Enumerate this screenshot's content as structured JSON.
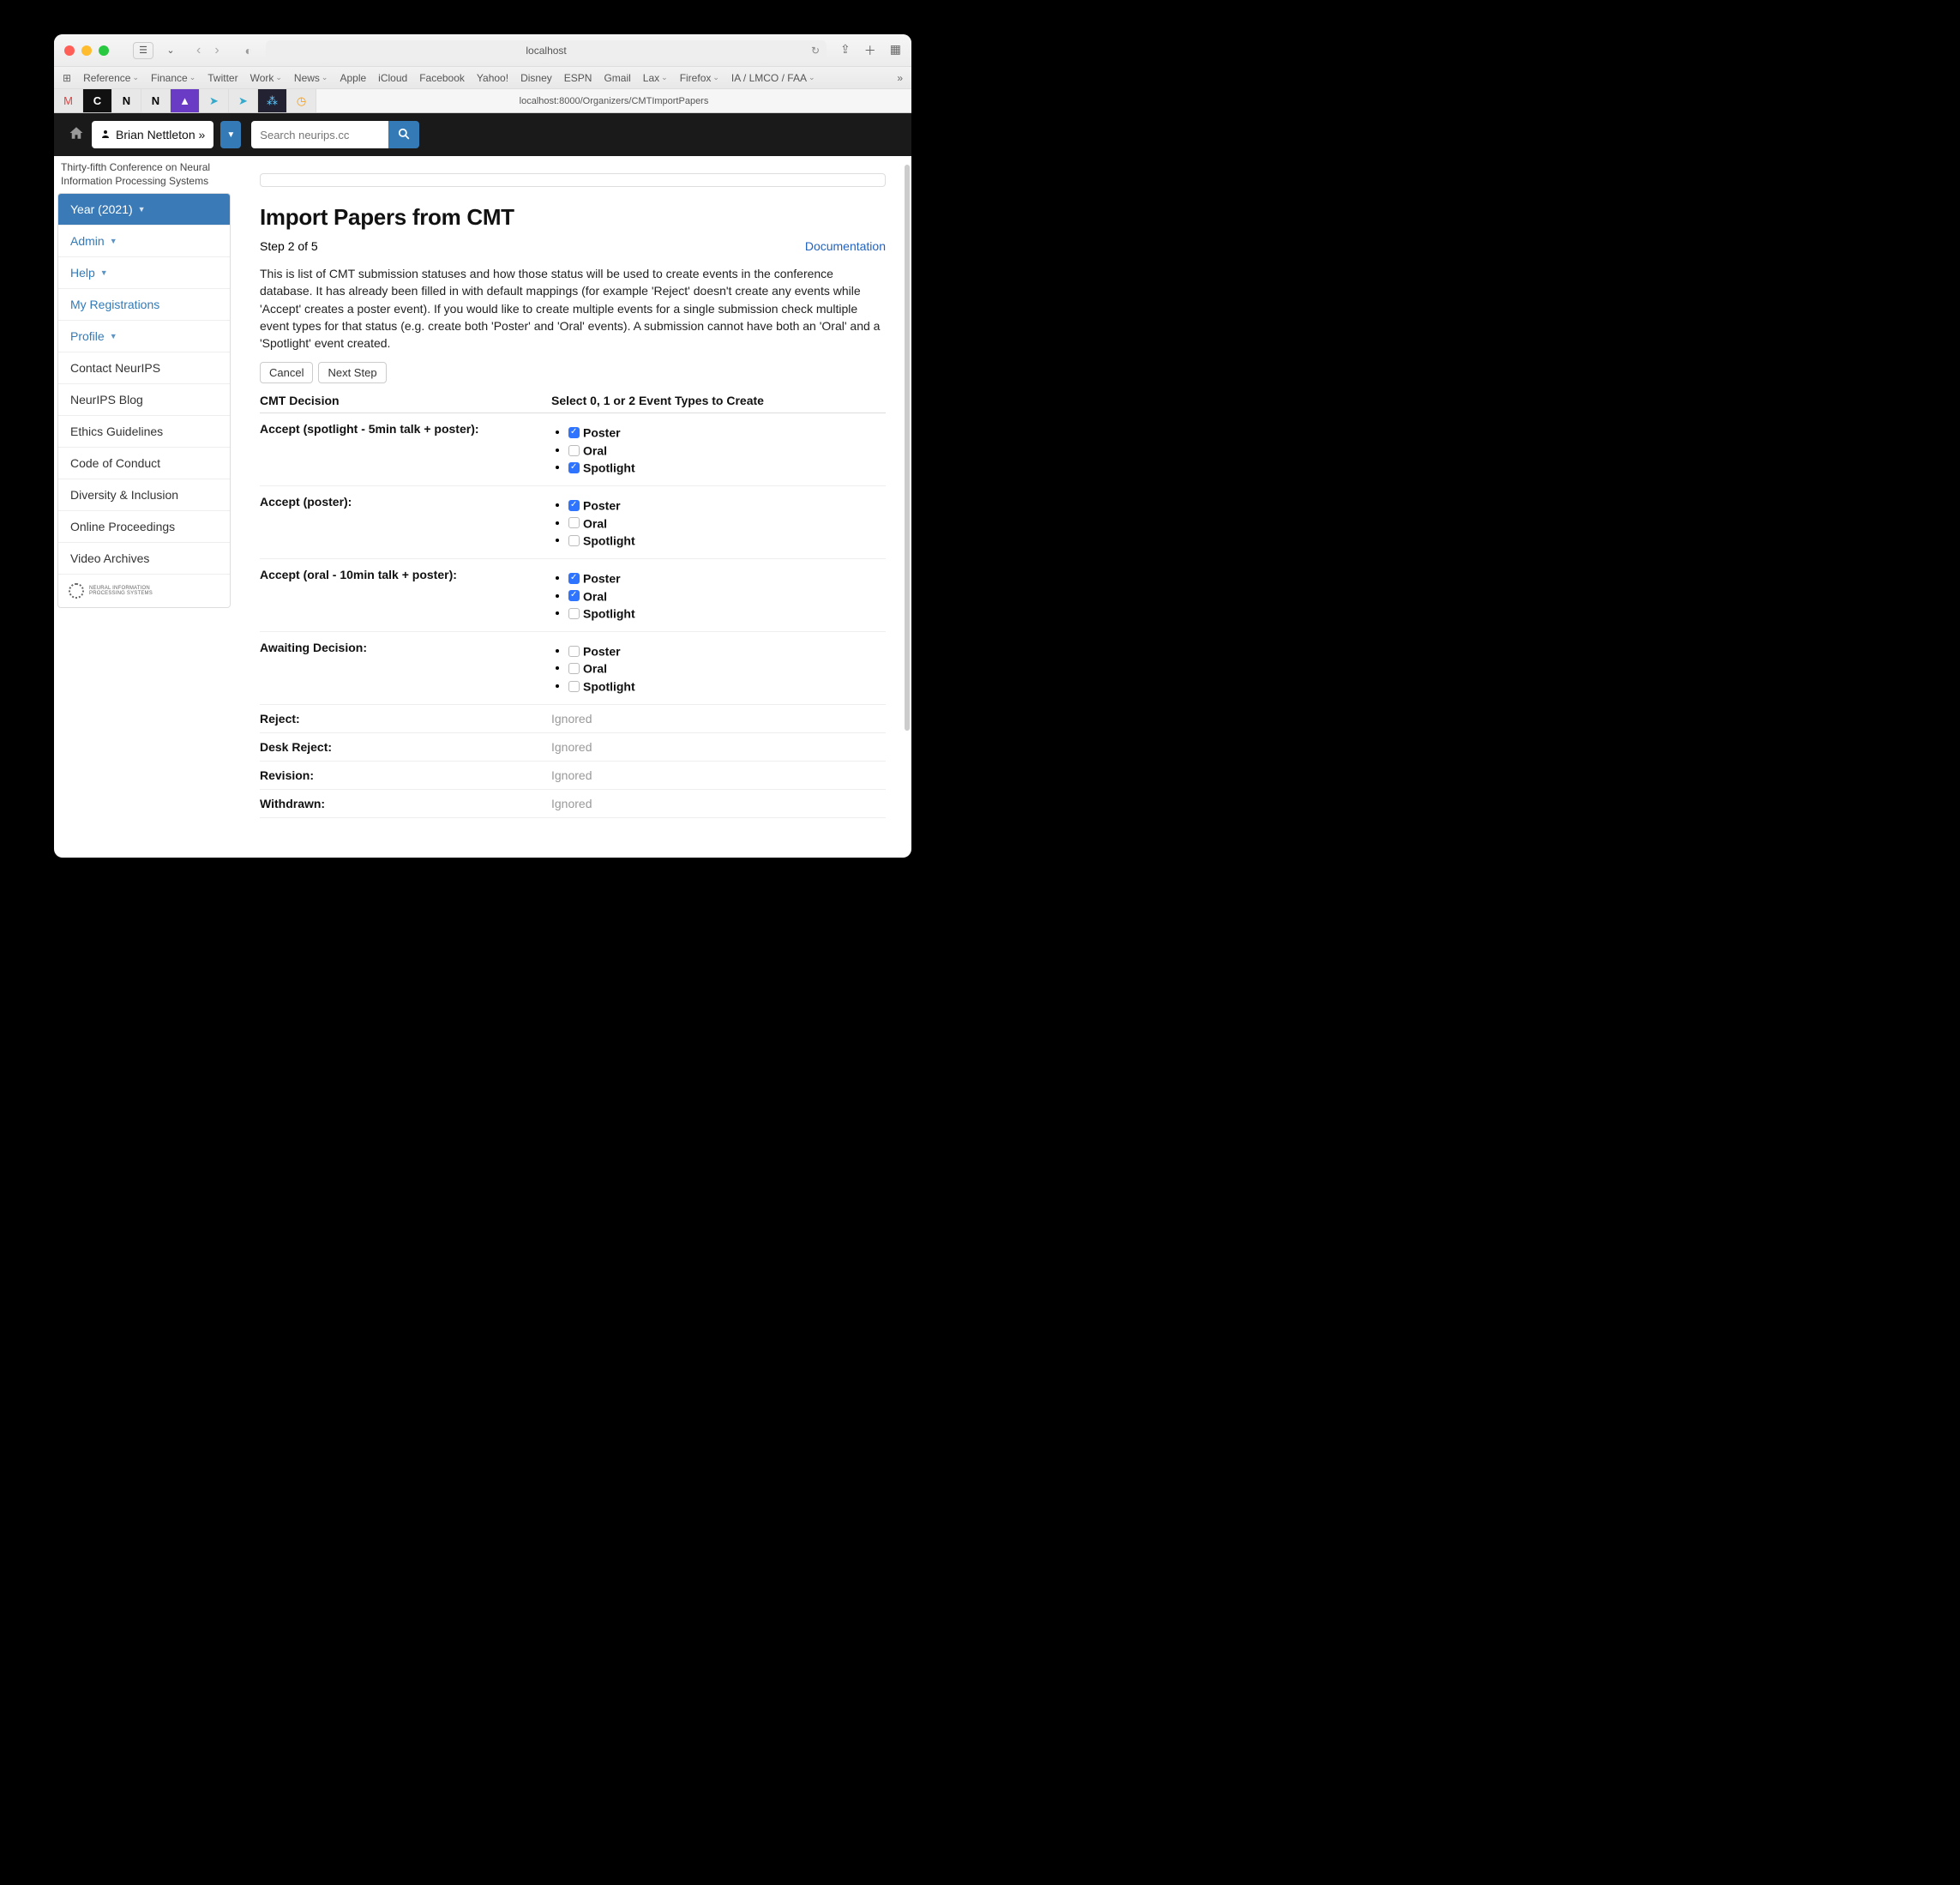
{
  "browser": {
    "address": "localhost",
    "bookmarks": [
      "Reference",
      "Finance",
      "Twitter",
      "Work",
      "News",
      "Apple",
      "iCloud",
      "Facebook",
      "Yahoo!",
      "Disney",
      "ESPN",
      "Gmail",
      "Lax",
      "Firefox",
      "IA / LMCO / FAA"
    ],
    "bookmark_has_menu": [
      true,
      true,
      false,
      true,
      true,
      false,
      false,
      false,
      false,
      false,
      false,
      false,
      true,
      true,
      true
    ],
    "active_tab": "localhost:8000/Organizers/CMTImportPapers"
  },
  "nav": {
    "user": "Brian Nettleton »",
    "search_placeholder": "Search neurips.cc"
  },
  "sidebar": {
    "conf_name": "Thirty-fifth Conference on Neural Information Processing Systems",
    "items": [
      {
        "label": "Year (2021)",
        "style": "active",
        "caret": true
      },
      {
        "label": "Admin",
        "style": "link",
        "caret": true
      },
      {
        "label": "Help",
        "style": "link",
        "caret": true
      },
      {
        "label": "My Registrations",
        "style": "link",
        "caret": false
      },
      {
        "label": "Profile",
        "style": "link",
        "caret": true
      },
      {
        "label": "Contact NeurIPS",
        "style": "plain",
        "caret": false
      },
      {
        "label": "NeurIPS Blog",
        "style": "plain",
        "caret": false
      },
      {
        "label": "Ethics Guidelines",
        "style": "plain",
        "caret": false
      },
      {
        "label": "Code of Conduct",
        "style": "plain",
        "caret": false
      },
      {
        "label": "Diversity & Inclusion",
        "style": "plain",
        "caret": false
      },
      {
        "label": "Online Proceedings",
        "style": "plain",
        "caret": false
      },
      {
        "label": "Video Archives",
        "style": "plain",
        "caret": false
      }
    ],
    "logo_text1": "NEURAL INFORMATION",
    "logo_text2": "PROCESSING SYSTEMS"
  },
  "main": {
    "title": "Import Papers from CMT",
    "step": "Step 2 of 5",
    "doc_link": "Documentation",
    "intro": "This is list of CMT submission statuses and how those status will be used to create events in the conference database. It has already been filled in with default mappings (for example 'Reject' doesn't create any events while 'Accept' creates a poster event). If you would like to create multiple events for a single submission check multiple event types for that status (e.g. create both 'Poster' and 'Oral' events). A submission cannot have both an 'Oral' and a 'Spotlight' event created.",
    "cancel": "Cancel",
    "next": "Next Step",
    "hdr_left": "CMT Decision",
    "hdr_right": "Select 0, 1 or 2 Event Types to Create",
    "event_types": [
      "Poster",
      "Oral",
      "Spotlight"
    ],
    "decisions": [
      {
        "label": "Accept (spotlight - 5min talk + poster):",
        "checks": [
          true,
          false,
          true
        ]
      },
      {
        "label": "Accept (poster):",
        "checks": [
          true,
          false,
          false
        ]
      },
      {
        "label": "Accept (oral - 10min talk + poster):",
        "checks": [
          true,
          true,
          false
        ]
      },
      {
        "label": "Awaiting Decision:",
        "checks": [
          false,
          false,
          false
        ]
      }
    ],
    "ignored_label": "Ignored",
    "ignored": [
      {
        "label": "Reject:"
      },
      {
        "label": "Desk Reject:"
      },
      {
        "label": "Revision:"
      },
      {
        "label": "Withdrawn:"
      }
    ]
  }
}
